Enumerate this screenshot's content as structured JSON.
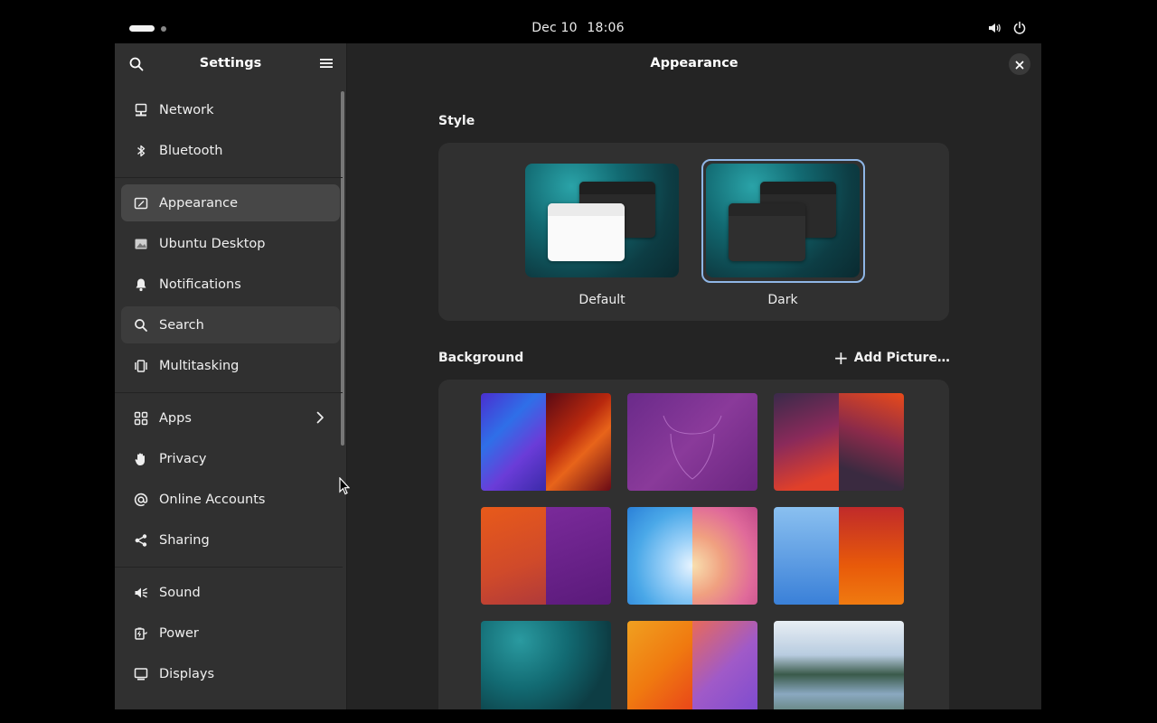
{
  "topbar": {
    "date": "Dec 10",
    "time": "18:06",
    "icons": [
      "workspace-indicator",
      "volume-icon",
      "power-icon"
    ]
  },
  "sidebar": {
    "title": "Settings",
    "items": [
      {
        "label": "Network",
        "icon": "network-icon"
      },
      {
        "label": "Bluetooth",
        "icon": "bluetooth-icon"
      },
      {
        "label": "Appearance",
        "icon": "appearance-icon",
        "state": "selected"
      },
      {
        "label": "Ubuntu Desktop",
        "icon": "ubuntu-desktop-icon"
      },
      {
        "label": "Notifications",
        "icon": "bell-icon"
      },
      {
        "label": "Search",
        "icon": "search-icon",
        "state": "hover"
      },
      {
        "label": "Multitasking",
        "icon": "multitasking-icon"
      },
      {
        "label": "Apps",
        "icon": "apps-grid-icon",
        "has_submenu": true
      },
      {
        "label": "Privacy",
        "icon": "hand-icon"
      },
      {
        "label": "Online Accounts",
        "icon": "at-sign-icon"
      },
      {
        "label": "Sharing",
        "icon": "share-icon"
      },
      {
        "label": "Sound",
        "icon": "speaker-icon"
      },
      {
        "label": "Power",
        "icon": "battery-icon"
      },
      {
        "label": "Displays",
        "icon": "display-icon"
      }
    ]
  },
  "content": {
    "title": "Appearance",
    "style": {
      "label": "Style",
      "options": [
        {
          "label": "Default",
          "selected": false
        },
        {
          "label": "Dark",
          "selected": true
        }
      ]
    },
    "background": {
      "label": "Background",
      "add_picture_label": "Add Picture…"
    }
  },
  "colors": {
    "accent_selection": "#8fb6e6",
    "window_bg": "#242424",
    "sidebar_bg": "#303030"
  }
}
